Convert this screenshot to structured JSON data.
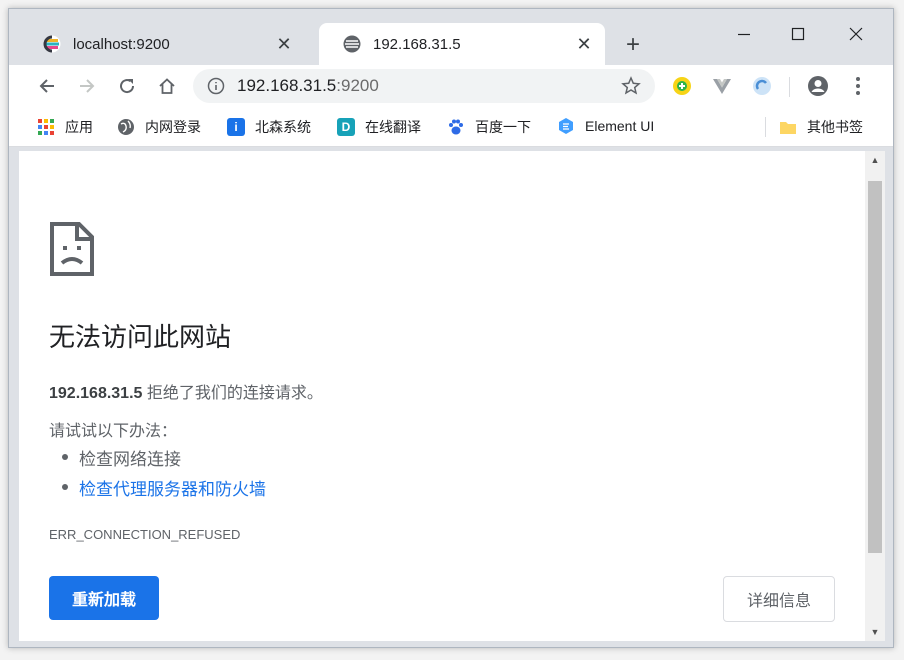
{
  "tabs": [
    {
      "title": "localhost:9200",
      "close": "✕"
    },
    {
      "title": "192.168.31.5",
      "close": "✕"
    }
  ],
  "new_tab_label": "+",
  "omnibox": {
    "host": "192.168.31.5",
    "port": ":9200"
  },
  "bookmarks": [
    {
      "label": "应用",
      "icon": "apps-grid-icon"
    },
    {
      "label": "内网登录",
      "icon": "globe-icon"
    },
    {
      "label": "北森系统",
      "icon": "info-icon",
      "glyph": "i",
      "color": "#1a73e8"
    },
    {
      "label": "在线翻译",
      "icon": "translate-icon",
      "glyph": "D",
      "color": "#17a2b8"
    },
    {
      "label": "百度一下",
      "icon": "baidu-icon"
    },
    {
      "label": "Element UI",
      "icon": "element-icon"
    },
    {
      "label": "其他书签",
      "icon": "folder-icon"
    }
  ],
  "error": {
    "title": "无法访问此网站",
    "host": "192.168.31.5",
    "description": " 拒绝了我们的连接请求。",
    "try_label": "请试试以下办法：",
    "suggestions": [
      "检查网络连接",
      "检查代理服务器和防火墙"
    ],
    "code": "ERR_CONNECTION_REFUSED",
    "reload_label": "重新加载",
    "details_label": "详细信息"
  },
  "colors": {
    "accent": "#1a73e8",
    "tab_strip": "#dee1e6"
  }
}
